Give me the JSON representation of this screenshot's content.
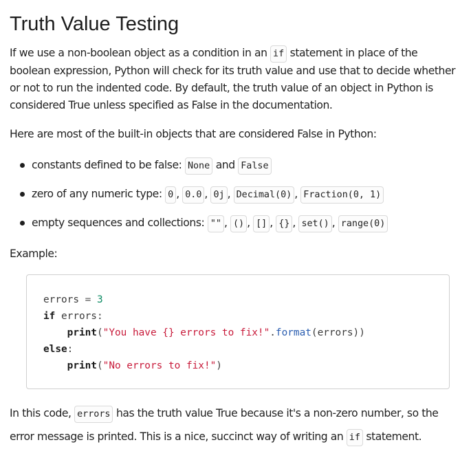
{
  "title": "Truth Value Testing",
  "intro": {
    "part1": "If we use a non-boolean object as a condition in an ",
    "code": "if",
    "part2": " statement in place of the boolean expression, Python will check for its truth value and use that to decide whether or not to run the indented code. By default, the truth value of an object in Python is considered True unless specified as False in the documentation."
  },
  "lead": "Here are most of the built-in objects that are considered False in Python:",
  "bullets": [
    {
      "text": "constants defined to be false: ",
      "codes": [
        "None",
        "False"
      ],
      "joiner": " and "
    },
    {
      "text": "zero of any numeric type: ",
      "codes": [
        "0",
        "0.0",
        "0j",
        "Decimal(0)",
        "Fraction(0, 1)"
      ]
    },
    {
      "text": "empty sequences and collections: ",
      "codes": [
        "\"\"",
        "()",
        "[]",
        "{}",
        "set()",
        "range(0)"
      ]
    }
  ],
  "example_label": "Example:",
  "code_sample": {
    "var": "errors",
    "assign": " = ",
    "value": "3",
    "kw_if": "if",
    "if_rest": " errors:",
    "print1": "print",
    "str1": "\"You have {} errors to fix!\"",
    "dot_format": ".",
    "format": "format",
    "args1": "(errors))",
    "kw_else": "else",
    "colon": ":",
    "print2": "print",
    "str2": "\"No errors to fix!\"",
    "close2": ")"
  },
  "closing": {
    "part1": "In this code, ",
    "code1": "errors",
    "part2": " has the truth value True because it's a non-zero number, so the error message is printed. This is a nice, succinct way of writing an ",
    "code2": "if",
    "part3": " statement."
  }
}
